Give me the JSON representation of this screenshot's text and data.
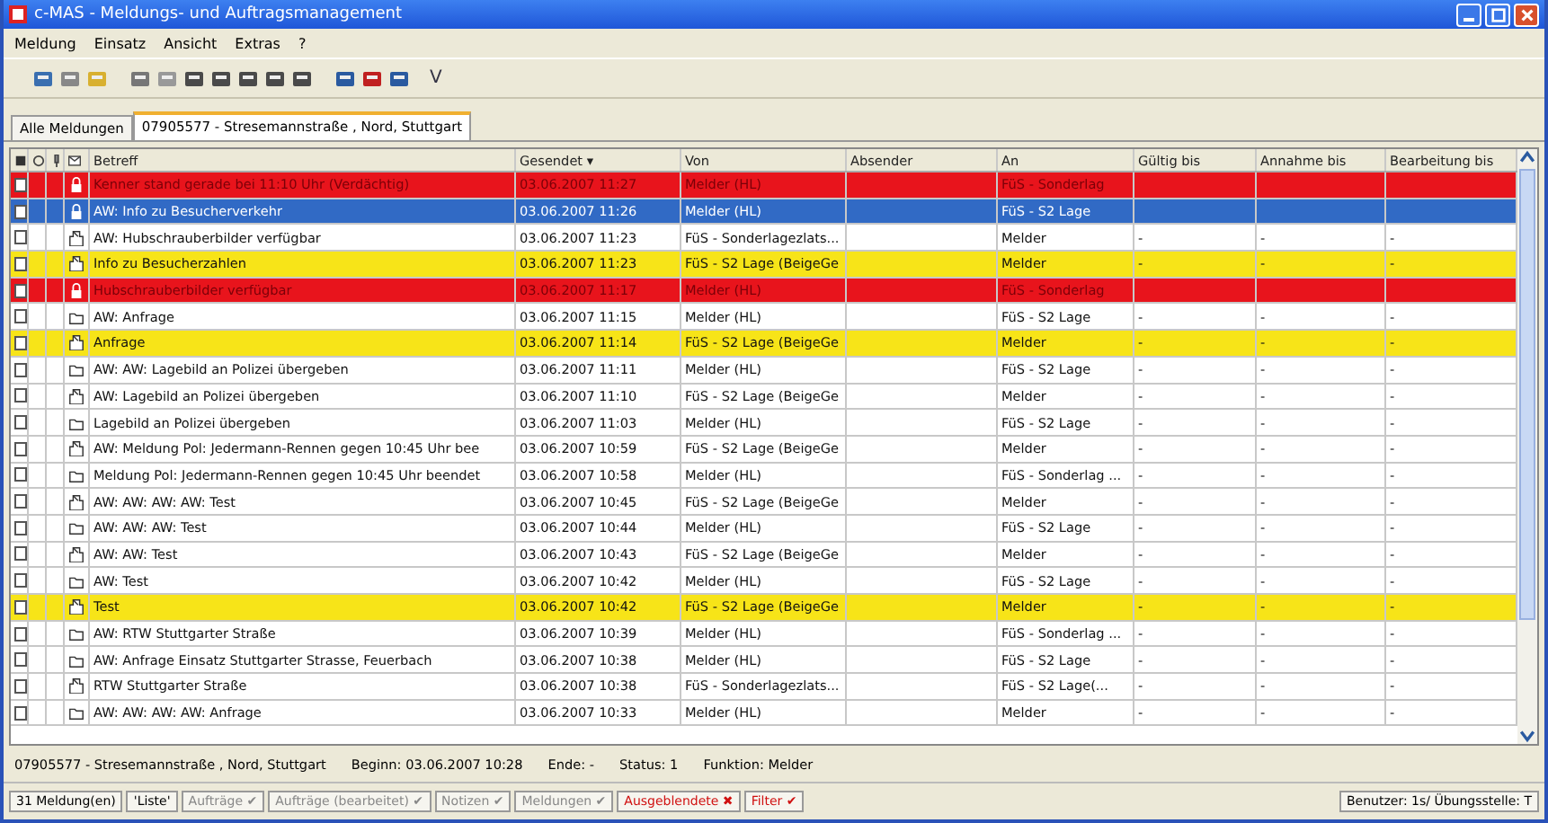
{
  "window": {
    "title": "c-MAS - Meldungs- und Auftragsmanagement"
  },
  "menu": [
    "Meldung",
    "Einsatz",
    "Ansicht",
    "Extras",
    "?"
  ],
  "toolbar": {
    "check_label": "V"
  },
  "tabs": [
    {
      "label": "Alle Meldungen",
      "selected": false
    },
    {
      "label": "07905577 - Stresemannstraße , Nord, Stuttgart",
      "selected": true
    }
  ],
  "table": {
    "columns": [
      "Betreff",
      "Gesendet ▾",
      "Von",
      "Absender",
      "An",
      "Gültig bis",
      "Annahme bis",
      "Bearbeitung bis"
    ],
    "rows": [
      {
        "checked": false,
        "selected": false,
        "color": "#e8141c",
        "kind": "closed",
        "betreff": "Kenner stand gerade bei 11:10 Uhr (Verdächtig)",
        "gesendet": "03.06.2007 11:27",
        "von": "Melder (HL)",
        "an": "FüS - Sonderlag"
      },
      {
        "checked": false,
        "selected": true,
        "kind": "closed",
        "betreff": "AW: Info zu Besucherverkehr",
        "gesendet": "03.06.2007 11:26",
        "von": "Melder (HL)",
        "an": "FüS - S2 Lage"
      },
      {
        "checked": false,
        "selected": false,
        "color": "#ffffff",
        "kind": "open",
        "betreff": "AW: Hubschrauberbilder verfügbar",
        "gesendet": "03.06.2007 11:23",
        "von": "FüS - Sonderlagezlats...",
        "an": "Melder",
        "gueltig": "-",
        "annahme": "-",
        "bearbeitung": "-"
      },
      {
        "checked": false,
        "selected": false,
        "color": "#f7e418",
        "kind": "open",
        "betreff": "Info zu Besucherzahlen",
        "gesendet": "03.06.2007 11:23",
        "von": "FüS - S2 Lage (BeigeGe",
        "an": "Melder",
        "gueltig": "-",
        "annahme": "-",
        "bearbeitung": "-"
      },
      {
        "checked": false,
        "selected": false,
        "color": "#e8141c",
        "kind": "closed",
        "betreff": "Hubschrauberbilder verfügbar",
        "gesendet": "03.06.2007 11:17",
        "von": "Melder (HL)",
        "an": "FüS - Sonderlag"
      },
      {
        "checked": false,
        "selected": false,
        "color": "#ffffff",
        "kind": "reply",
        "betreff": "AW: Anfrage",
        "gesendet": "03.06.2007 11:15",
        "von": "Melder (HL)",
        "an": "FüS - S2 Lage",
        "gueltig": "-",
        "annahme": "-",
        "bearbeitung": "-"
      },
      {
        "checked": false,
        "selected": false,
        "color": "#f7e418",
        "kind": "open",
        "betreff": "Anfrage",
        "gesendet": "03.06.2007 11:14",
        "von": "FüS - S2 Lage (BeigeGe",
        "an": "Melder",
        "gueltig": "-",
        "annahme": "-",
        "bearbeitung": "-"
      },
      {
        "checked": false,
        "selected": false,
        "color": "#ffffff",
        "kind": "reply",
        "betreff": "AW: AW: Lagebild an Polizei übergeben",
        "gesendet": "03.06.2007 11:11",
        "von": "Melder (HL)",
        "an": "FüS - S2 Lage",
        "gueltig": "-",
        "annahme": "-",
        "bearbeitung": "-"
      },
      {
        "checked": false,
        "selected": false,
        "color": "#ffffff",
        "kind": "open",
        "betreff": "AW: Lagebild an Polizei übergeben",
        "gesendet": "03.06.2007 11:10",
        "von": "FüS - S2 Lage (BeigeGe",
        "an": "Melder",
        "gueltig": "-",
        "annahme": "-",
        "bearbeitung": "-"
      },
      {
        "checked": false,
        "selected": false,
        "color": "#ffffff",
        "kind": "reply",
        "betreff": "Lagebild an Polizei übergeben",
        "gesendet": "03.06.2007 11:03",
        "von": "Melder (HL)",
        "an": "FüS - S2 Lage",
        "gueltig": "-",
        "annahme": "-",
        "bearbeitung": "-"
      },
      {
        "checked": false,
        "selected": false,
        "color": "#ffffff",
        "kind": "open",
        "betreff": "AW: Meldung Pol: Jedermann-Rennen gegen 10:45 Uhr bee",
        "gesendet": "03.06.2007 10:59",
        "von": "FüS - S2 Lage (BeigeGe",
        "an": "Melder",
        "gueltig": "-",
        "annahme": "-",
        "bearbeitung": "-"
      },
      {
        "checked": false,
        "selected": false,
        "color": "#ffffff",
        "kind": "reply",
        "betreff": "Meldung Pol: Jedermann-Rennen gegen 10:45 Uhr beendet",
        "gesendet": "03.06.2007 10:58",
        "von": "Melder (HL)",
        "an": "FüS - Sonderlag ...",
        "gueltig": "-",
        "annahme": "-",
        "bearbeitung": "-"
      },
      {
        "checked": false,
        "selected": false,
        "color": "#ffffff",
        "kind": "open",
        "betreff": "AW: AW: AW: AW: Test",
        "gesendet": "03.06.2007 10:45",
        "von": "FüS - S2 Lage (BeigeGe",
        "an": "Melder",
        "gueltig": "-",
        "annahme": "-",
        "bearbeitung": "-"
      },
      {
        "checked": false,
        "selected": false,
        "color": "#ffffff",
        "kind": "reply",
        "betreff": "AW: AW: AW: Test",
        "gesendet": "03.06.2007 10:44",
        "von": "Melder (HL)",
        "an": "FüS - S2 Lage",
        "gueltig": "-",
        "annahme": "-",
        "bearbeitung": "-"
      },
      {
        "checked": false,
        "selected": false,
        "color": "#ffffff",
        "kind": "open",
        "betreff": "AW: AW: Test",
        "gesendet": "03.06.2007 10:43",
        "von": "FüS - S2 Lage (BeigeGe",
        "an": "Melder",
        "gueltig": "-",
        "annahme": "-",
        "bearbeitung": "-"
      },
      {
        "checked": false,
        "selected": false,
        "color": "#ffffff",
        "kind": "reply",
        "betreff": "AW: Test",
        "gesendet": "03.06.2007 10:42",
        "von": "Melder (HL)",
        "an": "FüS - S2 Lage",
        "gueltig": "-",
        "annahme": "-",
        "bearbeitung": "-"
      },
      {
        "checked": false,
        "selected": false,
        "color": "#f7e418",
        "kind": "open",
        "betreff": "Test",
        "gesendet": "03.06.2007 10:42",
        "von": "FüS - S2 Lage (BeigeGe",
        "an": "Melder",
        "gueltig": "-",
        "annahme": "-",
        "bearbeitung": "-"
      },
      {
        "checked": false,
        "selected": false,
        "color": "#ffffff",
        "kind": "reply",
        "betreff": "AW: RTW Stuttgarter Straße",
        "gesendet": "03.06.2007 10:39",
        "von": "Melder (HL)",
        "an": "FüS - Sonderlag ...",
        "gueltig": "-",
        "annahme": "-",
        "bearbeitung": "-"
      },
      {
        "checked": false,
        "selected": false,
        "color": "#ffffff",
        "kind": "reply",
        "betreff": "AW: Anfrage Einsatz Stuttgarter Strasse, Feuerbach",
        "gesendet": "03.06.2007 10:38",
        "von": "Melder (HL)",
        "an": "FüS - S2 Lage",
        "gueltig": "-",
        "annahme": "-",
        "bearbeitung": "-"
      },
      {
        "checked": false,
        "selected": false,
        "color": "#ffffff",
        "kind": "open",
        "betreff": "RTW Stuttgarter Straße",
        "gesendet": "03.06.2007 10:38",
        "von": "FüS - Sonderlagezlats...",
        "an": "FüS - S2 Lage(... ",
        "gueltig": "-",
        "annahme": "-",
        "bearbeitung": "-"
      },
      {
        "checked": false,
        "selected": false,
        "color": "#ffffff",
        "kind": "reply",
        "betreff": "AW: AW: AW: AW: Anfrage",
        "gesendet": "03.06.2007 10:33",
        "von": "Melder (HL)",
        "an": "Melder",
        "gueltig": "-",
        "annahme": "-",
        "bearbeitung": "-"
      }
    ]
  },
  "info": [
    "07905577 - Stresemannstraße , Nord, Stuttgart",
    "Beginn: 03.06.2007 10:28",
    "Ende: -",
    "Status: 1",
    "Funktion: Melder"
  ],
  "status_bar": {
    "count": "31 Meldung(en)",
    "filters": [
      {
        "label": "'Liste'",
        "kind": "plain"
      },
      {
        "label": "Aufträge ✔",
        "kind": "grey"
      },
      {
        "label": "Aufträge (bearbeitet) ✔",
        "kind": "grey"
      },
      {
        "label": "Notizen ✔",
        "kind": "grey"
      },
      {
        "label": "Meldungen ✔",
        "kind": "grey"
      },
      {
        "label": "Ausgeblendete ✖",
        "kind": "red"
      },
      {
        "label": "Filter ✔",
        "kind": "red"
      }
    ],
    "user": "Benutzer: 1s/ Übungsstelle: T"
  }
}
